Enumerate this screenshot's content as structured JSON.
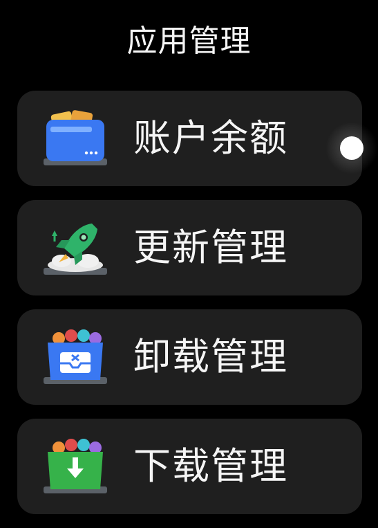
{
  "header": {
    "title": "应用管理"
  },
  "menu": {
    "items": [
      {
        "label": "账户余额",
        "icon": "wallet-icon"
      },
      {
        "label": "更新管理",
        "icon": "rocket-icon"
      },
      {
        "label": "卸载管理",
        "icon": "uninstall-box-icon"
      },
      {
        "label": "下载管理",
        "icon": "download-box-icon"
      }
    ]
  },
  "colors": {
    "background": "#000000",
    "card": "#1f1f1f",
    "text": "#f5f5f5",
    "wallet_blue": "#3a78f2",
    "wallet_paper": "#f2c14e",
    "rocket_green": "#2fb36a",
    "download_green": "#36b24a"
  }
}
